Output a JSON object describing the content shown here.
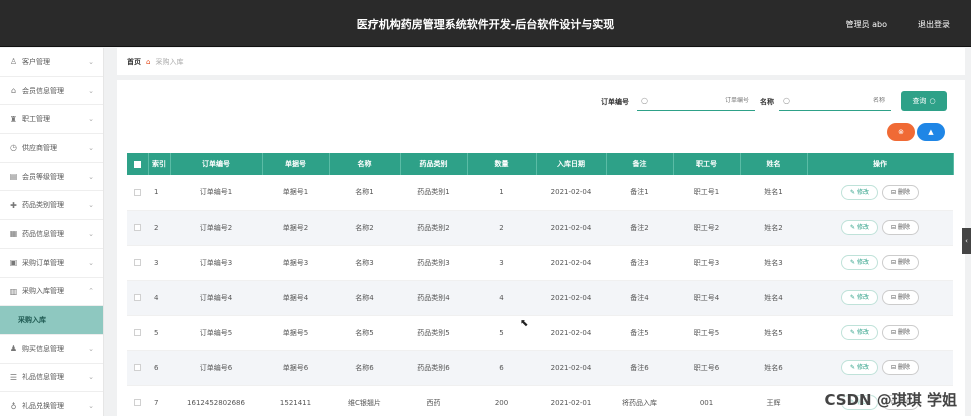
{
  "header": {
    "title": "医疗机构药房管理系统软件开发-后台软件设计与实现",
    "admin": "管理员 abo",
    "logout": "退出登录"
  },
  "sidebar": {
    "items": [
      {
        "label": "客户管理",
        "icon": "user-icon",
        "glyph": "♙"
      },
      {
        "label": "会员信息管理",
        "icon": "bank-icon",
        "glyph": "⌂"
      },
      {
        "label": "职工管理",
        "icon": "person-icon",
        "glyph": "♜"
      },
      {
        "label": "供应商管理",
        "icon": "clock-icon",
        "glyph": "◷"
      },
      {
        "label": "会员等级管理",
        "icon": "list-icon",
        "glyph": "▤"
      },
      {
        "label": "药品类别管理",
        "icon": "pill-icon",
        "glyph": "✚"
      },
      {
        "label": "药品信息管理",
        "icon": "grid-icon",
        "glyph": "▦"
      },
      {
        "label": "采购订单管理",
        "icon": "document-icon",
        "glyph": "▣"
      },
      {
        "label": "采购入库管理",
        "icon": "box-icon",
        "glyph": "▥",
        "expanded": true
      },
      {
        "label": "采购入库",
        "sub": true
      },
      {
        "label": "购买信息管理",
        "icon": "person-icon",
        "glyph": "♟"
      },
      {
        "label": "礼品信息管理",
        "icon": "menu-icon",
        "glyph": "☰"
      },
      {
        "label": "礼品兑换管理",
        "icon": "gift-icon",
        "glyph": "♁"
      }
    ]
  },
  "breadcrumb": {
    "home": "首页",
    "current": "采购入库"
  },
  "search": {
    "order_label": "订单编号",
    "order_placeholder": "订单编号",
    "name_label": "名称",
    "name_placeholder": "名称",
    "query_button": "查询"
  },
  "actions": {
    "delete_glyph": "⊗",
    "add_glyph": "▲"
  },
  "table": {
    "headers": [
      "索引",
      "订单编号",
      "单据号",
      "名称",
      "药品类别",
      "数量",
      "入库日期",
      "备注",
      "职工号",
      "姓名",
      "操作"
    ],
    "edit_label": "修改",
    "delete_label": "删除",
    "rows": [
      [
        "1",
        "订单编号1",
        "单据号1",
        "名称1",
        "药品类别1",
        "1",
        "2021-02-04",
        "备注1",
        "职工号1",
        "姓名1"
      ],
      [
        "2",
        "订单编号2",
        "单据号2",
        "名称2",
        "药品类别2",
        "2",
        "2021-02-04",
        "备注2",
        "职工号2",
        "姓名2"
      ],
      [
        "3",
        "订单编号3",
        "单据号3",
        "名称3",
        "药品类别3",
        "3",
        "2021-02-04",
        "备注3",
        "职工号3",
        "姓名3"
      ],
      [
        "4",
        "订单编号4",
        "单据号4",
        "名称4",
        "药品类别4",
        "4",
        "2021-02-04",
        "备注4",
        "职工号4",
        "姓名4"
      ],
      [
        "5",
        "订单编号5",
        "单据号5",
        "名称5",
        "药品类别5",
        "5",
        "2021-02-04",
        "备注5",
        "职工号5",
        "姓名5"
      ],
      [
        "6",
        "订单编号6",
        "单据号6",
        "名称6",
        "药品类别6",
        "6",
        "2021-02-04",
        "备注6",
        "职工号6",
        "姓名6"
      ],
      [
        "7",
        "1612452802686",
        "1521411",
        "维C银翘片",
        "西药",
        "200",
        "2021-02-01",
        "将药品入库",
        "001",
        "王辉"
      ]
    ]
  },
  "watermark": "CSDN @琪琪 学姐",
  "colors": {
    "accent": "#2ea188",
    "header_bg": "#2a2a2a",
    "delete_pill": "#f06a35",
    "add_pill": "#1f86e6",
    "sidebar_active": "#8ec8c0"
  }
}
